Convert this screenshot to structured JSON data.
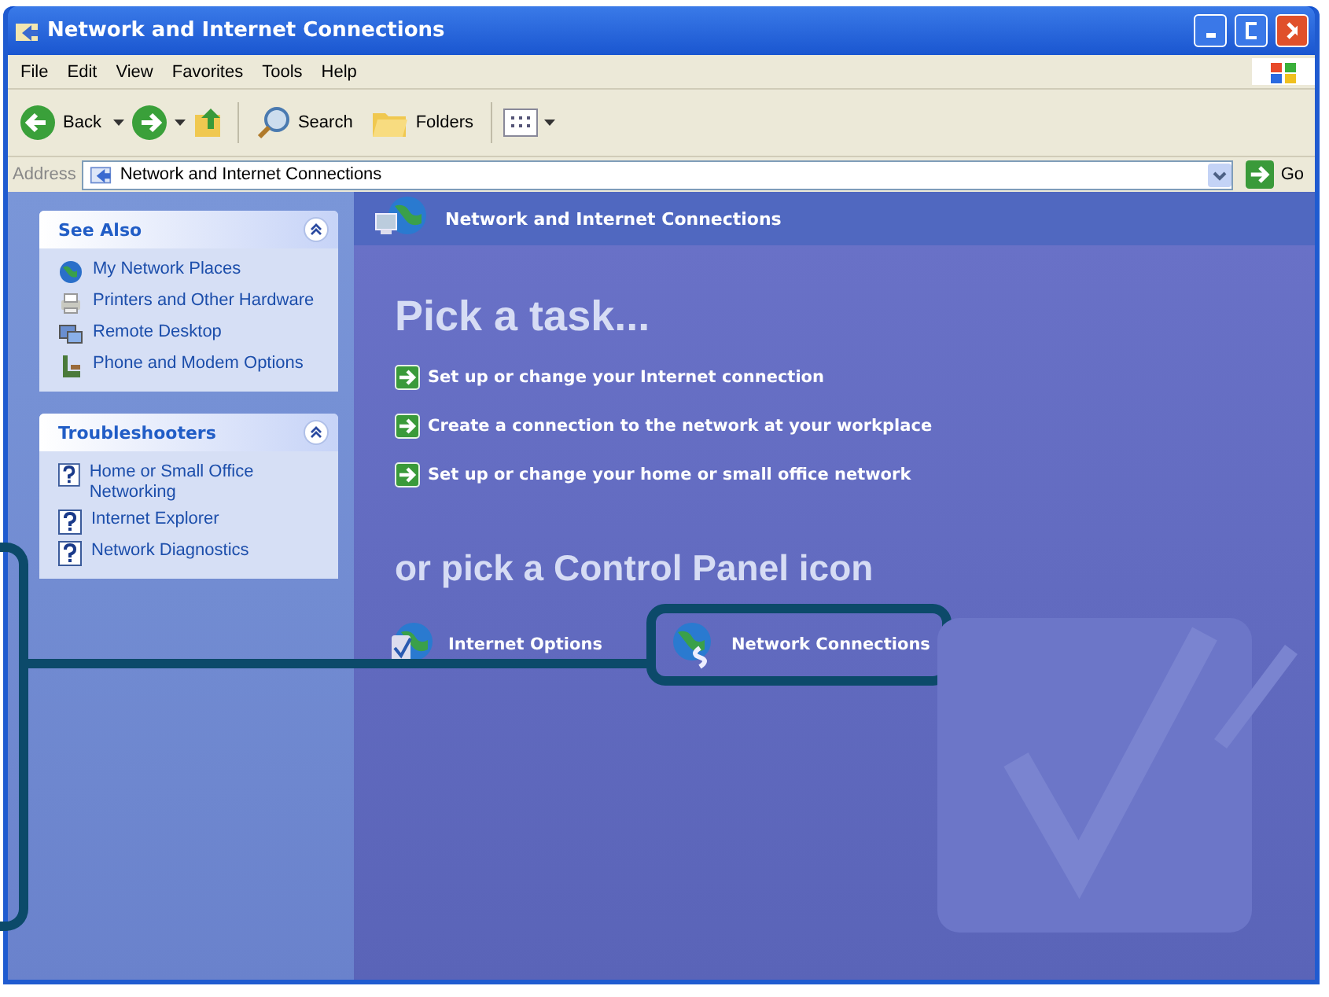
{
  "window": {
    "title": "Network and Internet Connections"
  },
  "menu": [
    "File",
    "Edit",
    "View",
    "Favorites",
    "Tools",
    "Help"
  ],
  "toolbar": {
    "back": "Back",
    "search": "Search",
    "folders": "Folders"
  },
  "address": {
    "label": "Address",
    "value": "Network and Internet Connections",
    "go": "Go"
  },
  "sidebar": [
    {
      "title": "See Also",
      "expanded": true,
      "items": [
        {
          "label": "My Network Places",
          "kind": "globe"
        },
        {
          "label": "Printers and Other Hardware",
          "kind": "printer"
        },
        {
          "label": "Remote Desktop",
          "kind": "remote"
        },
        {
          "label": "Phone and Modem Options",
          "kind": "phone"
        }
      ]
    },
    {
      "title": "Troubleshooters",
      "expanded": true,
      "items": [
        {
          "label": "Home or Small Office Networking",
          "kind": "help"
        },
        {
          "label": "Internet Explorer",
          "kind": "help"
        },
        {
          "label": "Network Diagnostics",
          "kind": "help"
        }
      ]
    }
  ],
  "header": "Network and Internet Connections",
  "task_heading": "Pick a task...",
  "tasks": [
    "Set up or change your Internet connection",
    "Create a connection to the network at your workplace",
    "Set up or change your home or small office network"
  ],
  "icon_heading": "or pick a Control Panel icon",
  "icons": [
    {
      "label": "Internet Options",
      "kind": "options",
      "highlighted": false
    },
    {
      "label": "Network Connections",
      "kind": "connections",
      "highlighted": true
    }
  ]
}
